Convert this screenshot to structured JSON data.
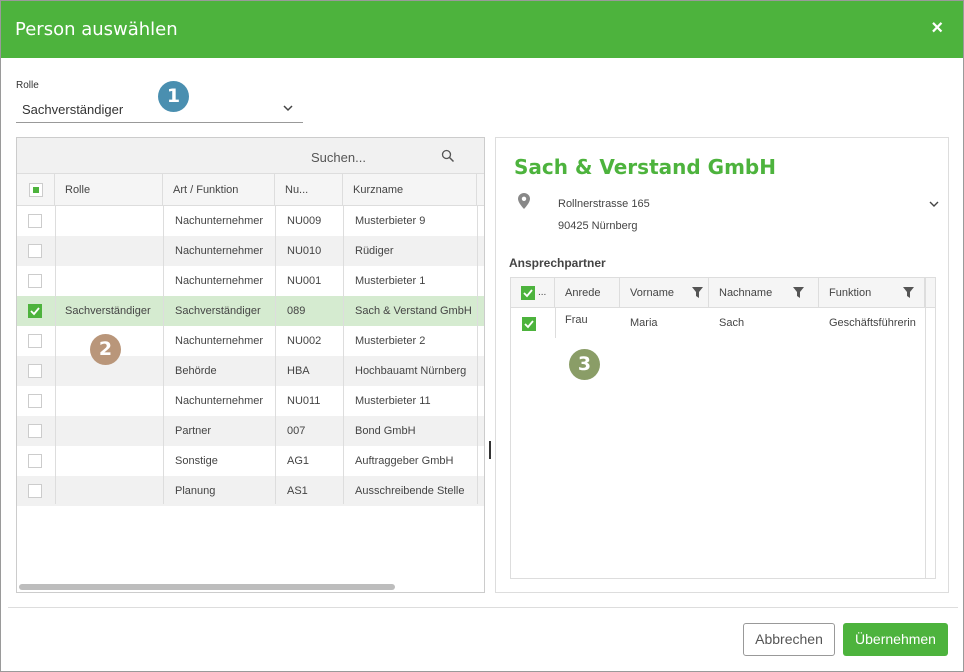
{
  "dialog": {
    "title": "Person auswählen",
    "close_label": "×"
  },
  "role": {
    "label": "Rolle",
    "value": "Sachverständiger"
  },
  "badges": {
    "one": "1",
    "two": "2",
    "three": "3"
  },
  "search": {
    "placeholder": "Suchen..."
  },
  "grid": {
    "headers": {
      "rolle": "Rolle",
      "art": "Art / Funktion",
      "nu": "Nu...",
      "kurzname": "Kurzname"
    },
    "rows": [
      {
        "rolle": "",
        "art": "Nachunternehmer",
        "nu": "NU009",
        "kurzname": "Musterbieter 9",
        "checked": false
      },
      {
        "rolle": "",
        "art": "Nachunternehmer",
        "nu": "NU010",
        "kurzname": "Rüdiger",
        "checked": false
      },
      {
        "rolle": "",
        "art": "Nachunternehmer",
        "nu": "NU001",
        "kurzname": "Musterbieter 1",
        "checked": false
      },
      {
        "rolle": "Sachverständiger",
        "art": "Sachverständiger",
        "nu": "089",
        "kurzname": "Sach & Verstand GmbH",
        "checked": true
      },
      {
        "rolle": "",
        "art": "Nachunternehmer",
        "nu": "NU002",
        "kurzname": "Musterbieter 2",
        "checked": false
      },
      {
        "rolle": "",
        "art": "Behörde",
        "nu": "HBA",
        "kurzname": "Hochbauamt Nürnberg",
        "checked": false
      },
      {
        "rolle": "",
        "art": "Nachunternehmer",
        "nu": "NU011",
        "kurzname": "Musterbieter 11",
        "checked": false
      },
      {
        "rolle": "",
        "art": "Partner",
        "nu": "007",
        "kurzname": "Bond GmbH",
        "checked": false
      },
      {
        "rolle": "",
        "art": "Sonstige",
        "nu": "AG1",
        "kurzname": "Auftraggeber GmbH",
        "checked": false
      },
      {
        "rolle": "",
        "art": "Planung",
        "nu": "AS1",
        "kurzname": "Ausschreibende Stelle",
        "checked": false
      }
    ]
  },
  "detail": {
    "company": "Sach & Verstand GmbH",
    "street": "Rollnerstrasse  165",
    "city": "90425 Nürnberg",
    "contacts_title": "Ansprechpartner",
    "contacts_headers": {
      "check": "...",
      "anrede": "Anrede",
      "vorname": "Vorname",
      "nachname": "Nachname",
      "funktion": "Funktion"
    },
    "contacts": [
      {
        "anrede": "Frau",
        "vorname": "Maria",
        "nachname": "Sach",
        "funktion": "Geschäftsführerin"
      }
    ]
  },
  "footer": {
    "cancel": "Abbrechen",
    "ok": "Übernehmen"
  },
  "colors": {
    "accent": "#4db33d",
    "selected_row": "#d5ebd0"
  }
}
